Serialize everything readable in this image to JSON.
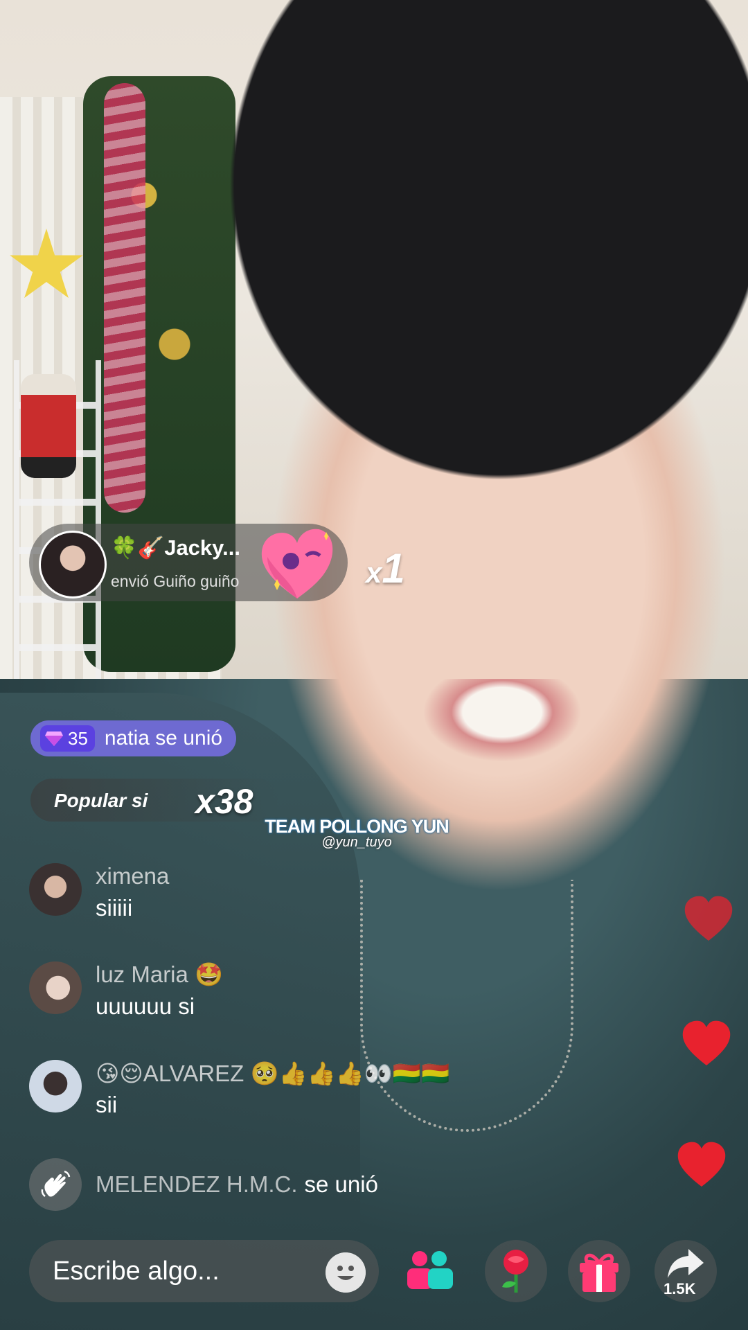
{
  "gift_banner": {
    "sender": "🍀🎸Jacky...",
    "message": "envió Guiño guiño",
    "count_prefix": "x",
    "count": "1"
  },
  "join_banner": {
    "level": "35",
    "text": "natia se unió"
  },
  "popular_banner": {
    "text": "Popular si",
    "count": "x38"
  },
  "watermark": {
    "title": "TEAM POLLONG YUN",
    "handle": "@yun_tuyo"
  },
  "comments": [
    {
      "user": "ximena",
      "text": "siiiii"
    },
    {
      "user": "luz Maria 🤩",
      "text": "uuuuuu si"
    },
    {
      "user": "😘😌ALVAREZ 🥺👍👍👍👀🇧🇴🇧🇴",
      "text": "sii"
    }
  ],
  "system_message": {
    "user": "MELENDEZ H.M.C.",
    "action": "se unió"
  },
  "bottom_bar": {
    "input_placeholder": "Escribe algo...",
    "share_count": "1.5K"
  },
  "colors": {
    "heart_red": "#e8222e",
    "join_purple": "#7a6ee6",
    "gift_pink": "#ff3b74",
    "collab_teal": "#22d3c5",
    "collab_pink": "#ff2d7a"
  },
  "icons": [
    "gift-heart-wink-icon",
    "gem-icon",
    "wave-hand-icon",
    "smile-icon",
    "collab-icon",
    "rose-icon",
    "gift-icon",
    "share-icon",
    "heart-icon"
  ]
}
